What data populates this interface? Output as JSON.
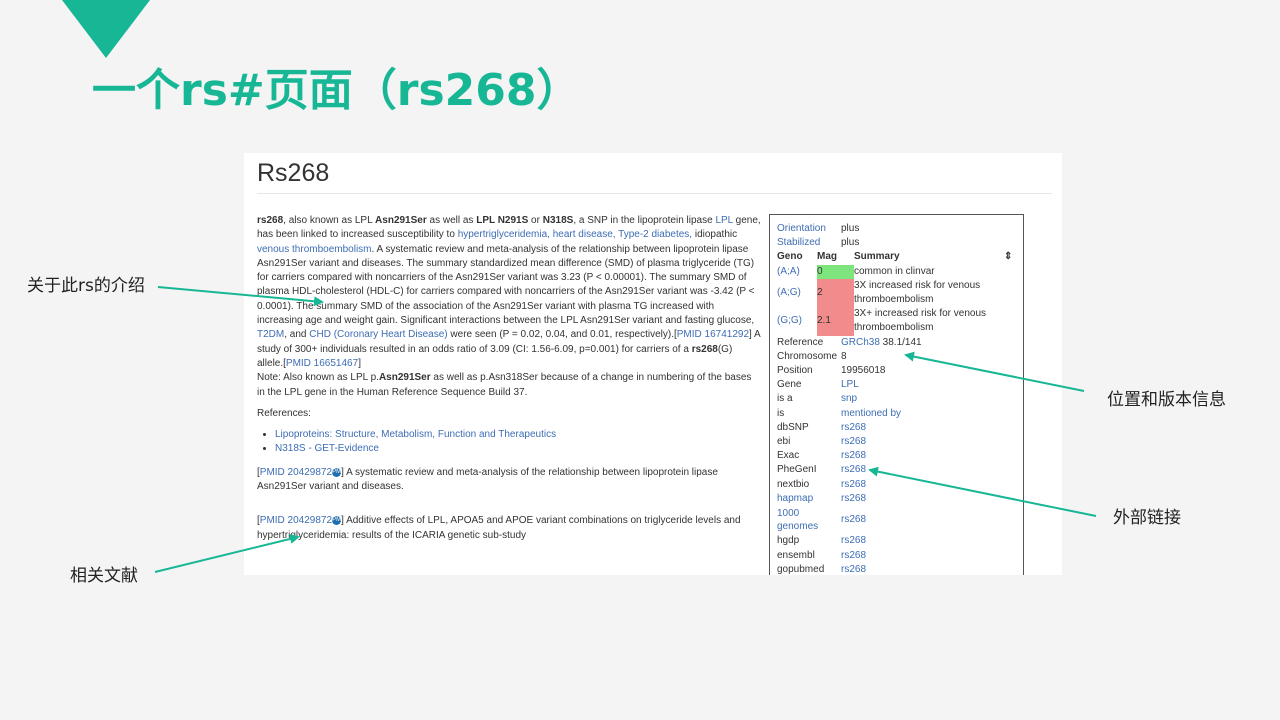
{
  "slide": {
    "title": "一个rs#页面（rs268）",
    "annotations": {
      "intro": "关于此rs的介绍",
      "position_version": "位置和版本信息",
      "external_links": "外部链接",
      "references": "相关文献"
    }
  },
  "page": {
    "heading": "Rs268",
    "article": {
      "p1": {
        "s1": "rs268",
        "s2": ", also known as LPL ",
        "s3": "Asn291Ser",
        "s4": " as well as ",
        "s5": "LPL N291S",
        "s6": " or ",
        "s7": "N318S",
        "s8": ", a SNP in the lipoprotein lipase ",
        "l1": "LPL",
        "s9": " gene, has been linked to increased susceptibility to ",
        "l2": "hypertriglyceridemia, heart disease, Type-2 diabetes,",
        "s10": " idiopathic ",
        "l3": "venous thromboembolism",
        "s11": ". A systematic review and meta-analysis of the relationship between lipoprotein lipase Asn291Ser variant and diseases. The summary standardized mean difference (SMD) of plasma triglyceride (TG) for carriers compared with noncarriers of the Asn291Ser variant was 3.23 (P < 0.00001). The summary SMD of plasma HDL-cholesterol (HDL-C) for carriers compared with noncarriers of the Asn291Ser variant was -3.42 (P < 0.0001). The summary SMD of the association of the Asn291Ser variant with plasma TG increased with increasing age and weight gain. Significant interactions between the LPL Asn291Ser variant and fasting glucose, ",
        "l4": "T2DM",
        "s12": ", and ",
        "l5": "CHD (Coronary Heart Disease)",
        "s13": " were seen (P = 0.02, 0.04, and 0.01, respectively).[",
        "l6": "PMID 16741292",
        "s14": "] A study of 300+ individuals resulted in an odds ratio of 3.09 (CI: 1.56-6.09, p=0.001) for carriers of a ",
        "s15": "rs268",
        "s16": "(G) allele.[",
        "l7": "PMID 16651467",
        "s17": "]"
      },
      "note": {
        "s1": "Note: Also known as LPL p.",
        "s2": "Asn291Ser",
        "s3": " as well as p.Asn318Ser because of a change in numbering of the bases in the LPL gene in the Human Reference Sequence Build 37."
      },
      "refs_label": "References:",
      "refs": [
        "Lipoproteins: Structure, Metabolism, Function and Therapeutics",
        "N318S - GET-Evidence"
      ],
      "cite1": {
        "pmid": "PMID 20429872",
        "badge": "PMC",
        "text": "] A systematic review and meta-analysis of the relationship between lipoprotein lipase Asn291Ser variant and diseases."
      },
      "cite2": {
        "pmid": "PMID 20429872",
        "badge": "PMC",
        "text": "] Additive effects of LPL, APOA5 and APOE variant combinations on triglyceride levels and hypertriglyceridemia: results of the ICARIA genetic sub-study"
      }
    },
    "infobox": {
      "orientation": {
        "label": "Orientation",
        "value": "plus"
      },
      "stabilized": {
        "label": "Stabilized",
        "value": "plus"
      },
      "geno_header": {
        "geno": "Geno",
        "mag": "Mag",
        "summary": "Summary",
        "sort": "⇕"
      },
      "genotypes": [
        {
          "geno": "(A;A)",
          "mag": "0",
          "summary": "common in clinvar",
          "color": "#7ee57e"
        },
        {
          "geno": "(A;G)",
          "mag": "2",
          "summary": "3X increased risk for venous thromboembolism",
          "color": "#f28b8b"
        },
        {
          "geno": "(G;G)",
          "mag": "2.1",
          "summary": "3X+ increased risk for venous thromboembolism",
          "color": "#f28b8b"
        }
      ],
      "reference": {
        "label": "Reference",
        "link": "GRCh38",
        "value": " 38.1/141"
      },
      "chromosome": {
        "label": "Chromosome",
        "value": "8"
      },
      "position": {
        "label": "Position",
        "value": "19956018"
      },
      "gene": {
        "label": "Gene",
        "value": "LPL"
      },
      "isa": {
        "label": "is a",
        "value": "snp"
      },
      "is": {
        "label": "is",
        "value": "mentioned by"
      },
      "links": [
        {
          "label": "dbSNP",
          "value": "rs268"
        },
        {
          "label": "ebi",
          "value": "rs268"
        },
        {
          "label": "Exac",
          "value": "rs268"
        },
        {
          "label": "PheGenI",
          "value": "rs268"
        },
        {
          "label": "nextbio",
          "value": "rs268"
        },
        {
          "label": "hapmap",
          "value": "rs268"
        },
        {
          "label": "1000 genomes",
          "value": "rs268"
        },
        {
          "label": "hgdp",
          "value": "rs268"
        },
        {
          "label": "ensembl",
          "value": "rs268"
        },
        {
          "label": "gopubmed",
          "value": "rs268"
        }
      ]
    }
  },
  "colors": {
    "accent": "#17b795",
    "link": "#3d6db4"
  }
}
